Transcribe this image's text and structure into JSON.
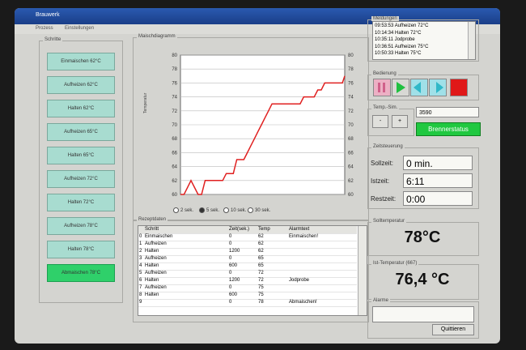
{
  "window": {
    "title": "Brauwerk"
  },
  "menu": {
    "items": [
      "Prozess",
      "Einstellungen"
    ]
  },
  "steps": {
    "label": "Schritte",
    "items": [
      "Einmaischen 62°C",
      "Aufheizen 62°C",
      "Halten 62°C",
      "Aufheizen 65°C",
      "Halten 65°C",
      "Aufheizen 72°C",
      "Halten 72°C",
      "Aufheizen 78°C",
      "Halten 78°C",
      "Abmaischen 78°C"
    ],
    "active_index": 9
  },
  "chart": {
    "label": "Maischdiagramm",
    "ylabel": "Temperatur"
  },
  "chart_data": {
    "type": "line",
    "x": [
      0,
      3,
      6,
      9,
      12,
      15,
      18,
      21,
      24,
      27,
      30,
      33,
      36,
      39,
      42,
      45,
      48,
      51,
      54,
      57,
      60,
      63,
      66,
      69,
      72,
      75,
      78,
      81,
      84,
      87,
      90,
      93,
      96,
      99,
      102,
      105,
      108,
      111,
      114,
      117,
      120,
      123,
      126,
      129,
      132,
      135,
      138,
      140
    ],
    "y": [
      60,
      60,
      61,
      62,
      61,
      60,
      60,
      62,
      62,
      62,
      62,
      62,
      62,
      63,
      63,
      63,
      65,
      65,
      65,
      66,
      67,
      68,
      69,
      70,
      71,
      72,
      73,
      73,
      73,
      73,
      73,
      73,
      73,
      73,
      73,
      74,
      74,
      74,
      74,
      75,
      75,
      76,
      76,
      76,
      76,
      76,
      76,
      77
    ],
    "ylim": [
      60,
      80
    ],
    "yticks": [
      60,
      62,
      64,
      66,
      68,
      70,
      72,
      74,
      76,
      78,
      80
    ],
    "grid": true
  },
  "interval": {
    "options": [
      "2 sek.",
      "5 sek.",
      "10 sek.",
      "30 sek."
    ],
    "selected_index": 1
  },
  "recipe": {
    "label": "Rezeptdaten",
    "columns": [
      "Schritt",
      "Zeit(sek.)",
      "Temp",
      "Alarmtext"
    ],
    "rows": [
      {
        "n": "0",
        "schritt": "Einmaischen",
        "zeit": "0",
        "temp": "62",
        "alarm": "Einmaischen!"
      },
      {
        "n": "1",
        "schritt": "Aufheizen",
        "zeit": "0",
        "temp": "62",
        "alarm": ""
      },
      {
        "n": "2",
        "schritt": "Halten",
        "zeit": "1200",
        "temp": "62",
        "alarm": ""
      },
      {
        "n": "3",
        "schritt": "Aufheizen",
        "zeit": "0",
        "temp": "65",
        "alarm": ""
      },
      {
        "n": "4",
        "schritt": "Halten",
        "zeit": "600",
        "temp": "65",
        "alarm": ""
      },
      {
        "n": "5",
        "schritt": "Aufheizen",
        "zeit": "0",
        "temp": "72",
        "alarm": ""
      },
      {
        "n": "6",
        "schritt": "Halten",
        "zeit": "1200",
        "temp": "72",
        "alarm": "Jodprobe"
      },
      {
        "n": "7",
        "schritt": "Aufheizen",
        "zeit": "0",
        "temp": "75",
        "alarm": ""
      },
      {
        "n": "8",
        "schritt": "Halten",
        "zeit": "600",
        "temp": "75",
        "alarm": ""
      },
      {
        "n": "9",
        "schritt": "",
        "zeit": "0",
        "temp": "78",
        "alarm": "Abmaischen!"
      }
    ]
  },
  "messages": {
    "label": "Meldungen",
    "items": [
      "09:53:53  Aufheizen 72°C",
      "10:14:34  Halten 72°C",
      "10:35:11  Jodprobe",
      "10:36:51  Aufheizen 75°C",
      "10:50:33  Halten 75°C"
    ]
  },
  "bedienung": {
    "label": "Bedienung"
  },
  "tempsim": {
    "label": "Temp.-Sim.",
    "minus": "-",
    "plus": "+",
    "value": "3590",
    "brenner": "Brennerstatus"
  },
  "zeitsteuerung": {
    "label": "Zeitsteuerung",
    "soll_label": "Sollzeit:",
    "soll_value": "0 min.",
    "ist_label": "Istzeit:",
    "ist_value": "6:11",
    "rest_label": "Restzeit:",
    "rest_value": "0:00"
  },
  "solltemp": {
    "label": "Solltemperatur",
    "value": "78°C"
  },
  "isttemp": {
    "label": "Ist-Temperatur (667)",
    "value": "76,4 °C"
  },
  "alarme": {
    "label": "Alarme",
    "quit": "Quittieren"
  }
}
